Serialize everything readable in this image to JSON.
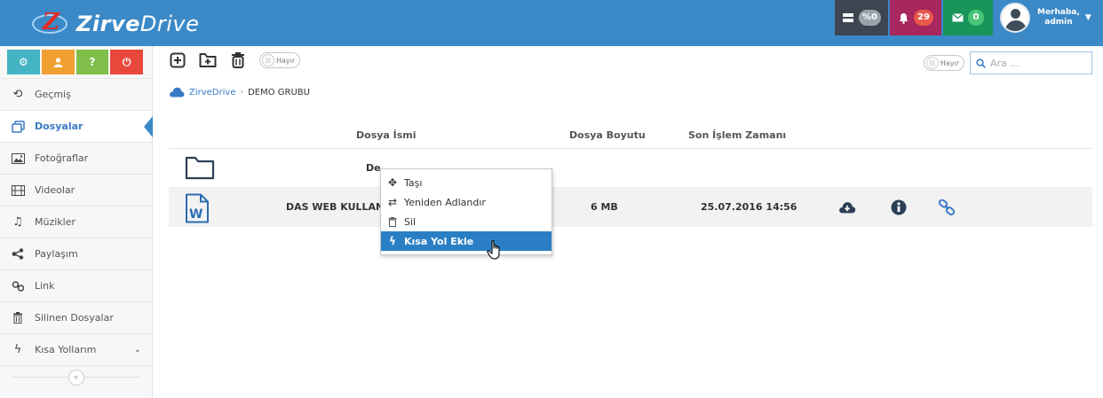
{
  "brand": {
    "logo_bold": "Zirve",
    "logo_rest": "Drive"
  },
  "topbar": {
    "disk_badge": "%0",
    "notifications_badge": "29",
    "messages_badge": "0",
    "greeting": "Merhaba,",
    "username": "admin"
  },
  "sidebar": {
    "items": [
      {
        "label": "Geçmiş",
        "icon": "history-icon"
      },
      {
        "label": "Dosyalar",
        "icon": "files-icon",
        "active": true
      },
      {
        "label": "Fotoğraflar",
        "icon": "photo-icon"
      },
      {
        "label": "Videolar",
        "icon": "film-icon"
      },
      {
        "label": "Müzikler",
        "icon": "music-icon"
      },
      {
        "label": "Paylaşım",
        "icon": "share-icon"
      },
      {
        "label": "Link",
        "icon": "link-icon"
      },
      {
        "label": "Silinen Dosyalar",
        "icon": "trash-icon"
      },
      {
        "label": "Kısa Yollarım",
        "icon": "bolt-icon"
      }
    ]
  },
  "toolbar": {
    "toggle_label": "Hayır"
  },
  "right_toolbar": {
    "toggle_label": "Hayır",
    "search_placeholder": "Ara ..."
  },
  "breadcrumb": {
    "root": "ZirveDrive",
    "current": "DEMO GRUBU"
  },
  "table": {
    "columns": [
      "Dosya İsmi",
      "Dosya Boyutu",
      "Son İşlem Zamanı"
    ],
    "rows": [
      {
        "type": "folder",
        "name": "De",
        "size": "",
        "modified": ""
      },
      {
        "type": "word",
        "name": "DAS WEB KULLAN",
        "size": "6 MB",
        "modified": "25.07.2016 14:56"
      }
    ]
  },
  "context_menu": {
    "items": [
      {
        "label": "Taşı",
        "icon": "move-icon"
      },
      {
        "label": "Yeniden Adlandır",
        "icon": "rename-icon"
      },
      {
        "label": "Sil",
        "icon": "trash-icon"
      },
      {
        "label": "Kısa Yol Ekle",
        "icon": "bolt-icon",
        "highlighted": true
      }
    ]
  },
  "colors": {
    "header": "#3b89c7",
    "accent": "#3979c4",
    "menu_highlight": "#2a7fc4"
  }
}
